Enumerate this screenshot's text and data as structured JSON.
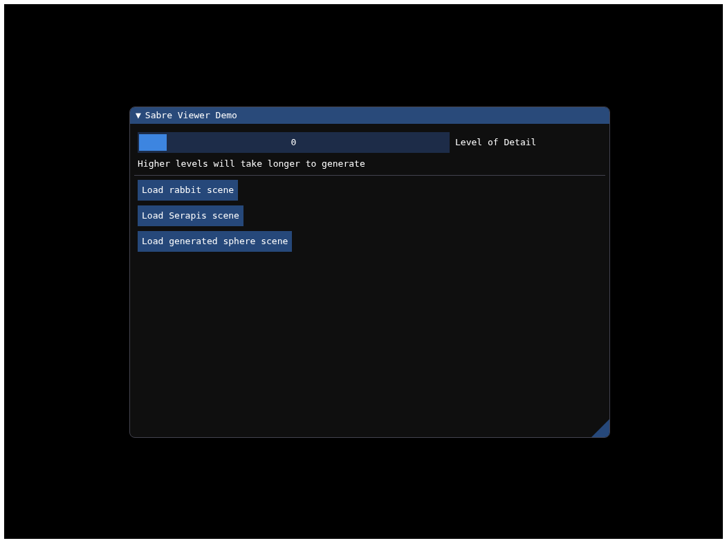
{
  "window": {
    "title": "Sabre Viewer Demo",
    "collapse_glyph": "▼",
    "expanded": true
  },
  "slider": {
    "value": "0",
    "label": "Level of Detail",
    "level": 0
  },
  "hint": "Higher levels will take longer to generate",
  "buttons": [
    "Load rabbit scene",
    "Load Serapis scene",
    "Load generated sphere scene"
  ]
}
